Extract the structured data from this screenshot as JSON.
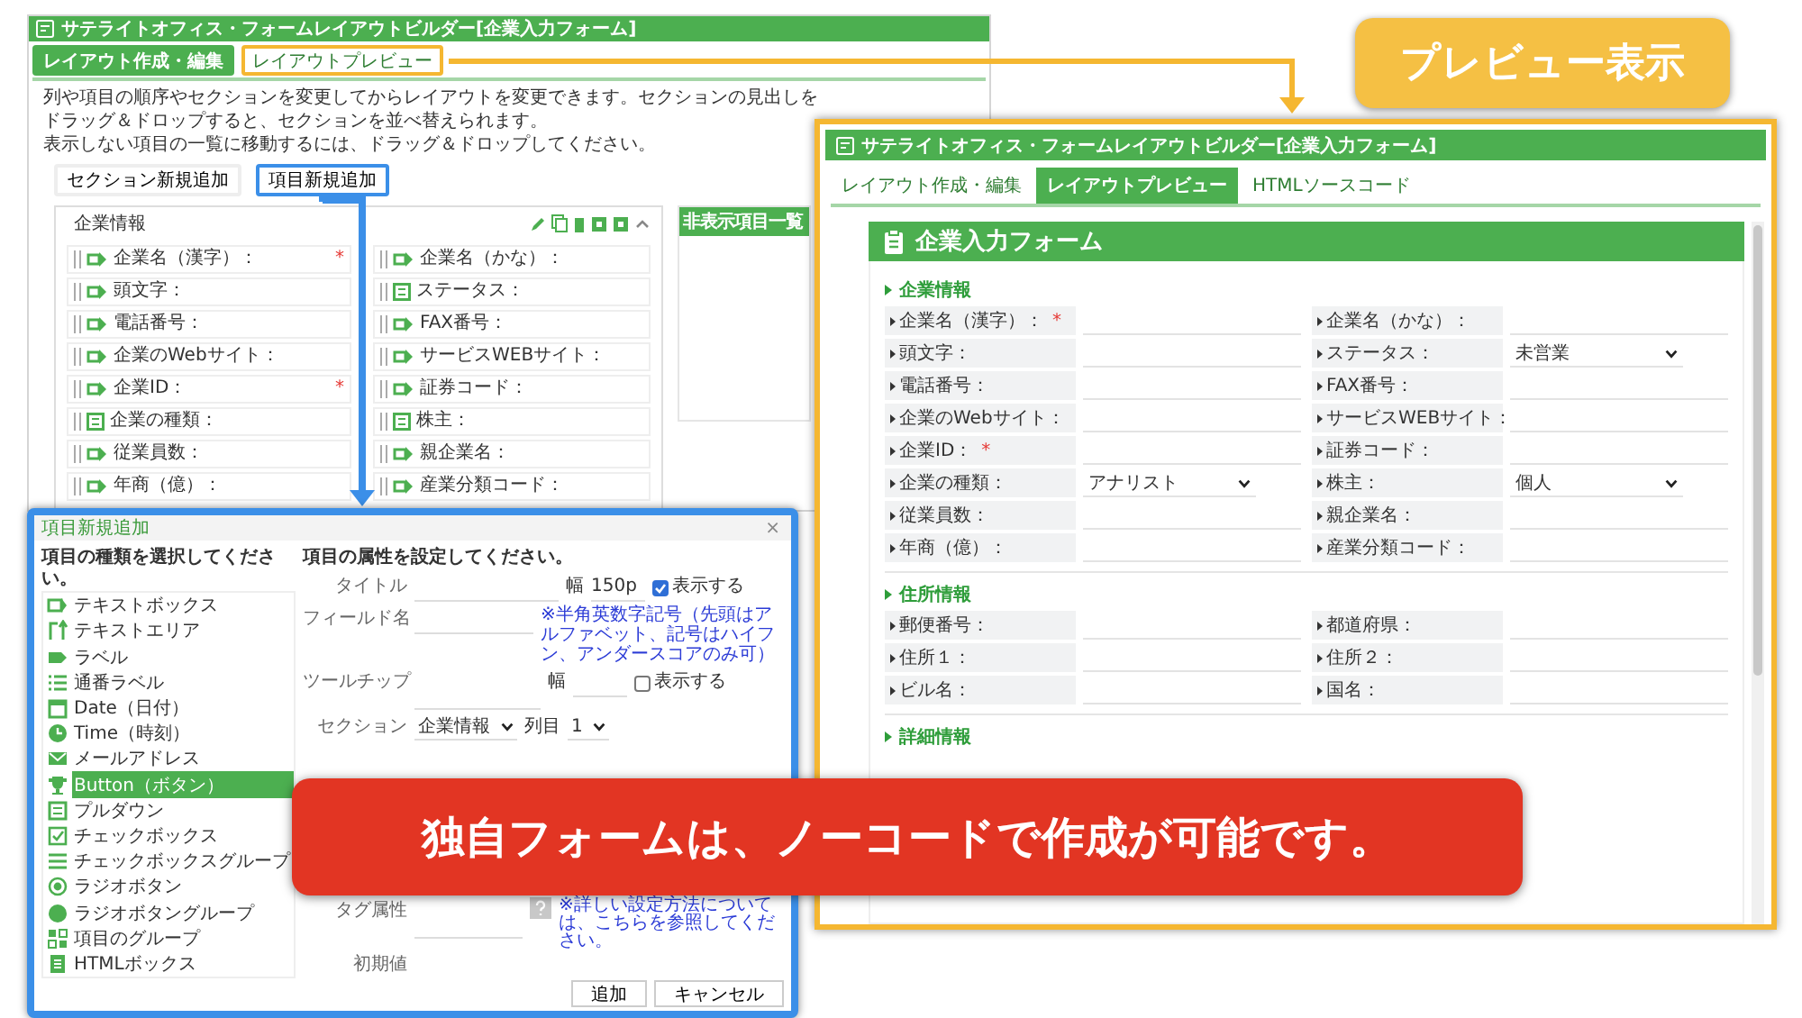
{
  "builder": {
    "title": "サテライトオフィス・フォームレイアウトビルダー[企業入力フォーム]",
    "tabs": [
      {
        "label": "レイアウト作成・編集",
        "selected": true,
        "highlighted": false
      },
      {
        "label": "レイアウトプレビュー",
        "selected": false,
        "highlighted": true
      }
    ],
    "instructions": [
      "列や項目の順序やセクションを変更してからレイアウトを変更できます。セクションの見出しをドラッグ＆ドロップすると、セクションを並べ替えられます。",
      "表示しない項目の一覧に移動するには、ドラッグ＆ドロップしてください。"
    ],
    "buttons": [
      {
        "label": "セクション新規追加",
        "highlighted": false
      },
      {
        "label": "項目新規追加",
        "highlighted": true
      }
    ],
    "section": {
      "title": "企業情報",
      "fields": [
        {
          "label": "企業名（漢字）：",
          "kind": "text",
          "required_mark": "*"
        },
        {
          "label": "企業名（かな）：",
          "kind": "text"
        },
        {
          "label": "頭文字：",
          "kind": "text"
        },
        {
          "label": "ステータス：",
          "kind": "select"
        },
        {
          "label": "電話番号：",
          "kind": "text"
        },
        {
          "label": "FAX番号：",
          "kind": "text"
        },
        {
          "label": "企業のWebサイト：",
          "kind": "text"
        },
        {
          "label": "サービスWEBサイト：",
          "kind": "text"
        },
        {
          "label": "企業ID：",
          "kind": "text",
          "required_mark": "*"
        },
        {
          "label": "証券コード：",
          "kind": "text"
        },
        {
          "label": "企業の種類：",
          "kind": "select"
        },
        {
          "label": "株主：",
          "kind": "select"
        },
        {
          "label": "従業員数：",
          "kind": "text"
        },
        {
          "label": "親企業名：",
          "kind": "text"
        },
        {
          "label": "年商（億）：",
          "kind": "text"
        },
        {
          "label": "産業分類コード：",
          "kind": "text"
        }
      ]
    },
    "hidden_panel": {
      "title": "非表示項目一覧"
    }
  },
  "callout": {
    "text": "プレビュー表示"
  },
  "preview": {
    "title": "サテライトオフィス・フォームレイアウトビルダー[企業入力フォーム]",
    "tabs": [
      {
        "label": "レイアウト作成・編集",
        "selected": false
      },
      {
        "label": "レイアウトプレビュー",
        "selected": true
      },
      {
        "label": "HTMLソースコード",
        "selected": false
      }
    ],
    "form_title": "企業入力フォーム",
    "sections": [
      {
        "title": "企業情報",
        "fields": [
          {
            "label": "企業名（漢字）：",
            "kind": "text",
            "required_mark": "*"
          },
          {
            "label": "企業名（かな）：",
            "kind": "text"
          },
          {
            "label": "頭文字：",
            "kind": "text"
          },
          {
            "label": "ステータス：",
            "kind": "select",
            "value": "未営業"
          },
          {
            "label": "電話番号：",
            "kind": "text"
          },
          {
            "label": "FAX番号：",
            "kind": "text"
          },
          {
            "label": "企業のWebサイト：",
            "kind": "text"
          },
          {
            "label": "サービスWEBサイト：",
            "kind": "text"
          },
          {
            "label": "企業ID：",
            "kind": "text",
            "required_mark": "*"
          },
          {
            "label": "証券コード：",
            "kind": "text"
          },
          {
            "label": "企業の種類：",
            "kind": "select",
            "value": "アナリスト"
          },
          {
            "label": "株主：",
            "kind": "select",
            "value": "個人"
          },
          {
            "label": "従業員数：",
            "kind": "text"
          },
          {
            "label": "親企業名：",
            "kind": "text"
          },
          {
            "label": "年商（億）：",
            "kind": "text"
          },
          {
            "label": "産業分類コード：",
            "kind": "text"
          }
        ]
      },
      {
        "title": "住所情報",
        "fields": [
          {
            "label": "郵便番号：",
            "kind": "text"
          },
          {
            "label": "都道府県：",
            "kind": "text"
          },
          {
            "label": "住所１：",
            "kind": "text"
          },
          {
            "label": "住所２：",
            "kind": "text"
          },
          {
            "label": "ビル名：",
            "kind": "text"
          },
          {
            "label": "国名：",
            "kind": "text"
          }
        ]
      },
      {
        "title": "詳細情報"
      }
    ]
  },
  "dialog": {
    "title": "項目新規追加",
    "close": "×",
    "left_heading": "項目の種類を選択してください。",
    "types": [
      {
        "label": "テキストボックス",
        "kind": "textbox",
        "selected": false
      },
      {
        "label": "テキストエリア",
        "kind": "textarea",
        "selected": false
      },
      {
        "label": "ラベル",
        "kind": "label",
        "selected": false
      },
      {
        "label": "通番ラベル",
        "kind": "serial",
        "selected": false
      },
      {
        "label": "Date（日付）",
        "kind": "date",
        "selected": false
      },
      {
        "label": "Time（時刻）",
        "kind": "time",
        "selected": false
      },
      {
        "label": "メールアドレス",
        "kind": "email",
        "selected": false
      },
      {
        "label": "Button（ボタン）",
        "kind": "button",
        "selected": true
      },
      {
        "label": "プルダウン",
        "kind": "pulldown",
        "selected": false
      },
      {
        "label": "チェックボックス",
        "kind": "checkbox",
        "selected": false
      },
      {
        "label": "チェックボックスグループ",
        "kind": "checkgroup",
        "selected": false
      },
      {
        "label": "ラジオボタン",
        "kind": "radio",
        "selected": false
      },
      {
        "label": "ラジオボタングループ",
        "kind": "radiogroup",
        "selected": false
      },
      {
        "label": "項目のグループ",
        "kind": "group",
        "selected": false
      },
      {
        "label": "HTMLボックス",
        "kind": "html",
        "selected": false
      }
    ],
    "right_heading": "項目の属性を設定してください。",
    "title_field": {
      "label": "タイトル",
      "width_label": "幅",
      "width_value": "150p",
      "show_label": "表示する",
      "show_checked": true
    },
    "field_name": {
      "label": "フィールド名",
      "note": "※半角英数字記号（先頭はアルファベット、記号はハイフン、アンダースコアのみ可）"
    },
    "tooltip": {
      "label": "ツールチップ",
      "width_label": "幅",
      "show_label": "表示する",
      "show_checked": false
    },
    "section": {
      "label": "セクション",
      "value": "企業情報",
      "column_label": "列目",
      "column_value": "1"
    },
    "tag": {
      "label": "タグ属性",
      "note": "※詳しい設定方法については、こちらを参照してください。"
    },
    "initial_value": {
      "label": "初期値"
    },
    "buttons": [
      "追加",
      "キャンセル"
    ]
  },
  "banner": {
    "text": "独自フォームは、ノーコードで作成が可能です。"
  }
}
